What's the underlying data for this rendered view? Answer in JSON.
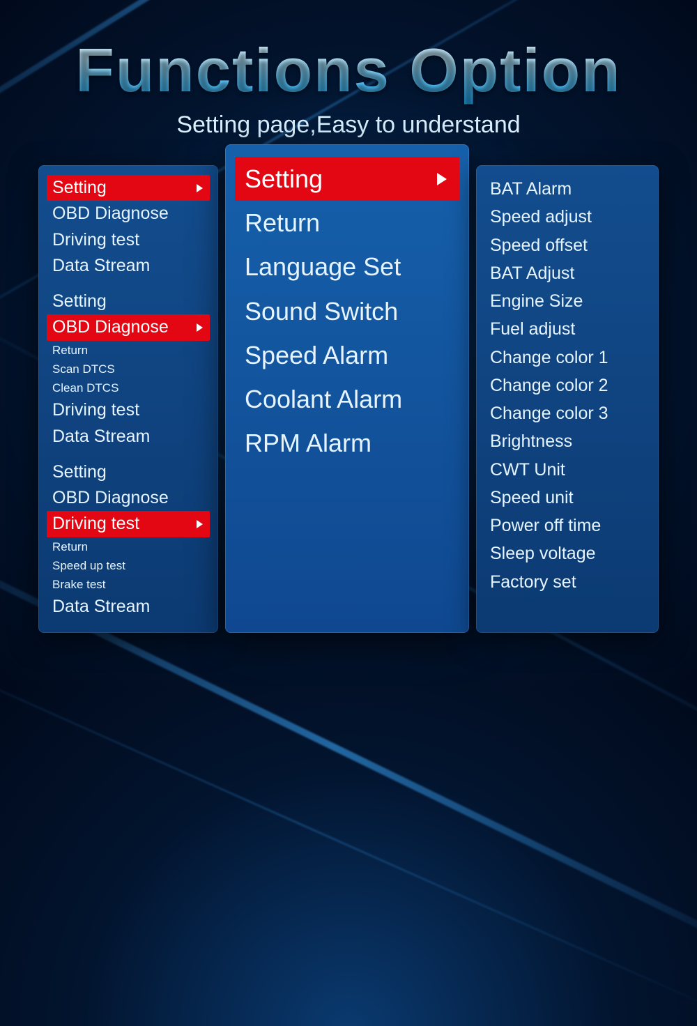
{
  "header": {
    "title": "Functions Option",
    "subtitle": "Setting page,Easy to understand"
  },
  "left": {
    "groups": [
      {
        "main": [
          {
            "label": "Setting",
            "selected": true
          },
          {
            "label": "OBD Diagnose"
          },
          {
            "label": "Driving test"
          },
          {
            "label": "Data Stream"
          }
        ]
      },
      {
        "main": [
          {
            "label": "Setting"
          },
          {
            "label": "OBD Diagnose",
            "selected": true
          }
        ],
        "sub": [
          {
            "label": "Return"
          },
          {
            "label": "Scan DTCS"
          },
          {
            "label": "Clean DTCS"
          }
        ],
        "tail": [
          {
            "label": "Driving test"
          },
          {
            "label": "Data Stream"
          }
        ]
      },
      {
        "main": [
          {
            "label": "Setting"
          },
          {
            "label": "OBD Diagnose"
          },
          {
            "label": "Driving test",
            "selected": true
          }
        ],
        "sub": [
          {
            "label": "Return"
          },
          {
            "label": "Speed up test"
          },
          {
            "label": "Brake test"
          }
        ],
        "tail": [
          {
            "label": "Data Stream"
          }
        ]
      }
    ]
  },
  "center": {
    "items": [
      {
        "label": "Setting",
        "selected": true
      },
      {
        "label": "Return"
      },
      {
        "label": "Language Set"
      },
      {
        "label": "Sound Switch"
      },
      {
        "label": "Speed Alarm"
      },
      {
        "label": "Coolant Alarm"
      },
      {
        "label": "RPM Alarm"
      }
    ]
  },
  "right": {
    "items": [
      "BAT Alarm",
      "Speed adjust",
      "Speed offset",
      "BAT Adjust",
      "Engine Size",
      "Fuel adjust",
      "Change color 1",
      "Change color 2",
      "Change color 3",
      "Brightness",
      "CWT Unit",
      "Speed unit",
      "Power off time",
      "Sleep voltage",
      "Factory set"
    ]
  },
  "colors": {
    "selected_bg": "#e30613",
    "panel_bg_top": "#134d8e",
    "panel_bg_bottom": "#0c3a72"
  }
}
